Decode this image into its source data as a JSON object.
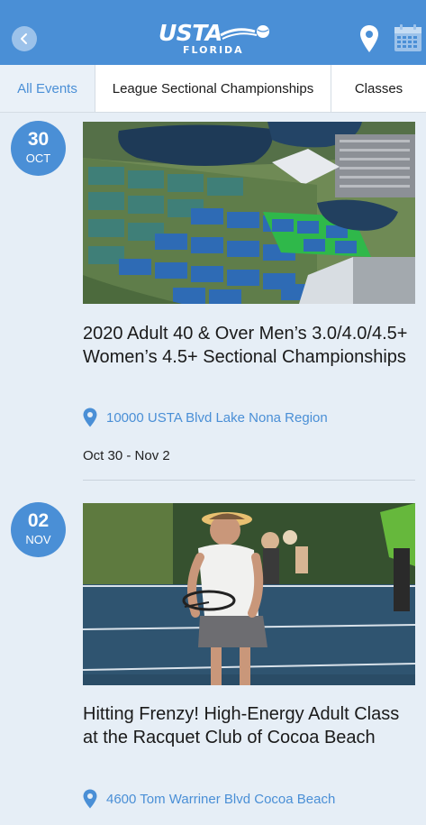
{
  "header": {
    "logo_text": "USTA",
    "logo_sub": "FLORIDA",
    "colors": {
      "primary": "#4a8fd6",
      "background": "#e6eef6"
    },
    "icons": [
      "back-icon",
      "location-pin-icon",
      "calendar-icon"
    ]
  },
  "tabs": [
    {
      "label": "All Events",
      "active": true
    },
    {
      "label": "League Sectional Championships",
      "active": false
    },
    {
      "label": "Classes",
      "active": false
    }
  ],
  "events": [
    {
      "day": "30",
      "month": "OCT",
      "title": "2020 Adult 40 & Over Men’s 3.0/4.0/4.5+ Women’s 4.5+ Sectional Championships",
      "location": "10000 USTA Blvd Lake Nona Region",
      "dates": "Oct 30 - Nov 2",
      "image": "aerial view of tennis center"
    },
    {
      "day": "02",
      "month": "NOV",
      "title": "Hitting Frenzy! High-Energy Adult Class at the Racquet Club of Cocoa Beach",
      "location": "4600 Tom Warriner Blvd Cocoa Beach",
      "image": "woman playing tennis"
    }
  ]
}
